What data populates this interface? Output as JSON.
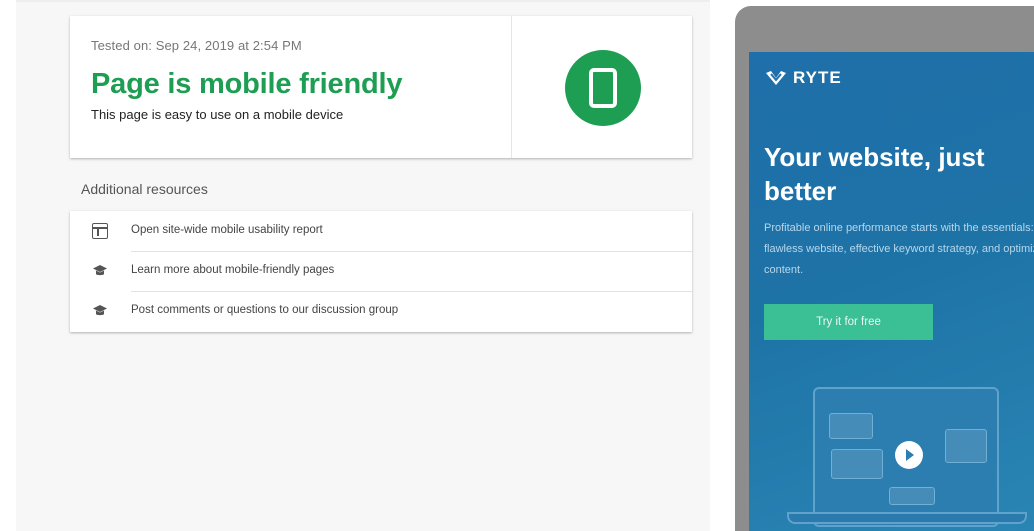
{
  "result": {
    "tested_on": "Tested on: Sep 24, 2019 at 2:54 PM",
    "title": "Page is mobile friendly",
    "description": "This page is easy to use on a mobile device",
    "status_color": "#1e9e52"
  },
  "resources": {
    "heading": "Additional resources",
    "items": [
      {
        "icon": "usability-report-icon",
        "label": "Open site-wide mobile usability report"
      },
      {
        "icon": "graduation-cap-icon",
        "label": "Learn more about mobile-friendly pages"
      },
      {
        "icon": "graduation-cap-icon",
        "label": "Post comments or questions to our discussion group"
      }
    ]
  },
  "ad": {
    "brand": "RYTE",
    "headline": "Your website, just better",
    "body": "Profitable online performance starts with the essentials: a flawless website, effective keyword strategy, and optimized content.",
    "cta": "Try it for free",
    "cta_color": "#3bbf95",
    "background_color": "#1f6faa"
  }
}
